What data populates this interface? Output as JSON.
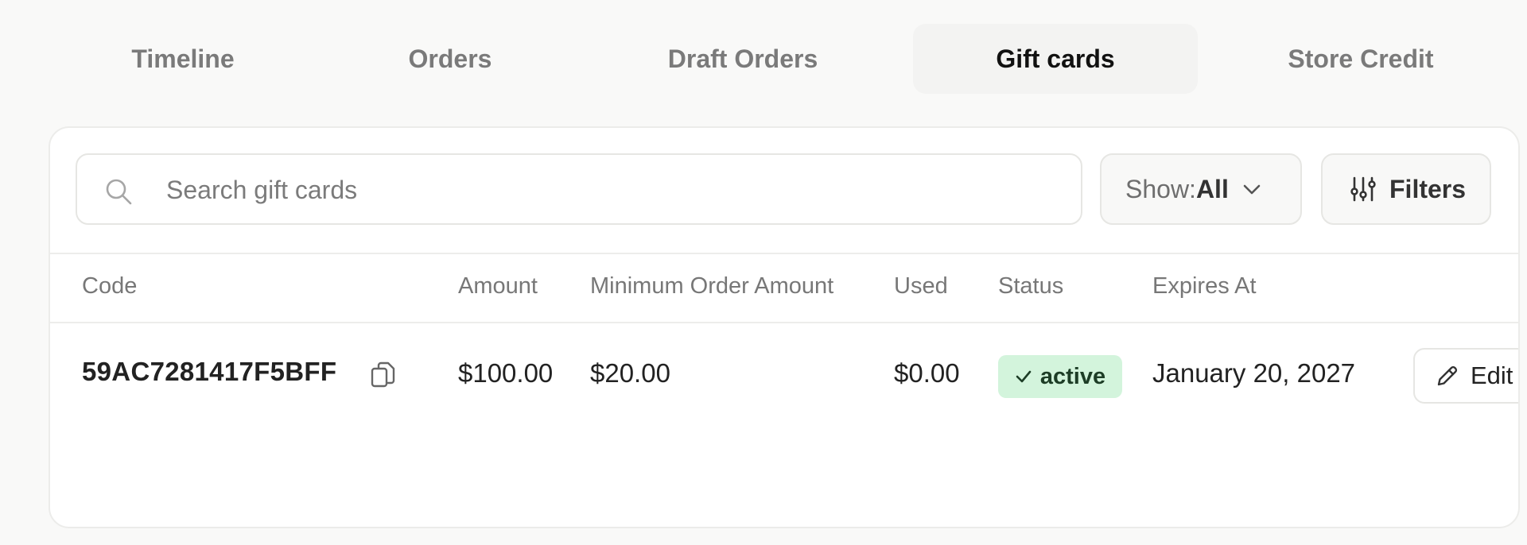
{
  "tabs": [
    {
      "label": "Timeline",
      "active": false
    },
    {
      "label": "Orders",
      "active": false
    },
    {
      "label": "Draft Orders",
      "active": false
    },
    {
      "label": "Gift cards",
      "active": true
    },
    {
      "label": "Store Credit",
      "active": false
    }
  ],
  "toolbar": {
    "search_placeholder": "Search gift cards",
    "search_value": "",
    "show_label": "Show:",
    "show_value": "All",
    "filters_label": "Filters"
  },
  "table": {
    "columns": [
      "Code",
      "Amount",
      "Minimum Order Amount",
      "Used",
      "Status",
      "Expires At"
    ],
    "rows": [
      {
        "code": "59AC7281417F5BFF",
        "amount": "$100.00",
        "minimum_order_amount": "$20.00",
        "used": "$0.00",
        "status": "active",
        "expires_at": "January 20, 2027",
        "edit_label": "Edit"
      }
    ]
  },
  "icons": {
    "search": "search-icon",
    "chevron": "chevron-down-icon",
    "filters": "sliders-icon",
    "copy": "copy-icon",
    "check": "check-icon",
    "edit": "pencil-icon"
  },
  "colors": {
    "page_background": "#f9f9f8",
    "active_badge_bg": "#d3f4dc",
    "active_badge_text": "#1d3d26",
    "active_tab_text": "#111111",
    "inactive_tab_text": "#7a7a7a"
  }
}
